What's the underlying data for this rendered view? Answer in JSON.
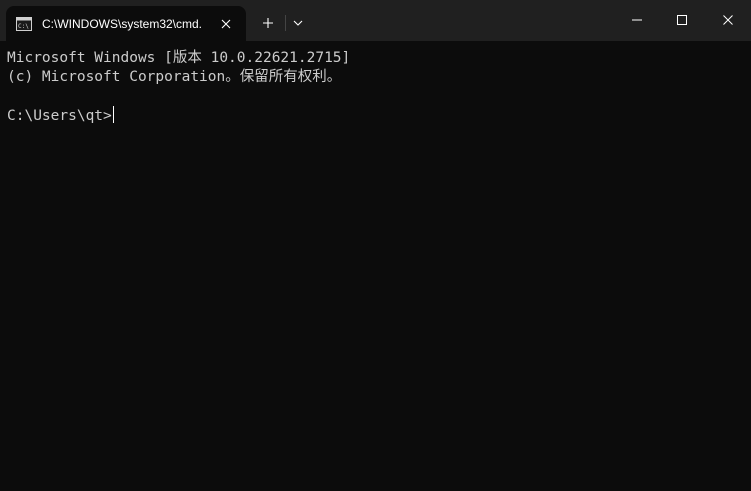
{
  "window": {
    "tab_title": "C:\\WINDOWS\\system32\\cmd.",
    "tab_icon": "console-app-icon",
    "close_tab_icon": "close-icon",
    "new_tab_icon": "plus-icon",
    "dropdown_icon": "chevron-down-icon",
    "minimize_icon": "minimize-icon",
    "maximize_icon": "maximize-icon",
    "close_window_icon": "close-icon"
  },
  "terminal": {
    "lines": [
      "Microsoft Windows [版本 10.0.22621.2715]",
      "(c) Microsoft Corporation。保留所有权利。",
      "",
      "C:\\Users\\qt>"
    ]
  },
  "colors": {
    "background": "#0c0c0c",
    "titlebar": "#202020",
    "text": "#cccccc"
  }
}
